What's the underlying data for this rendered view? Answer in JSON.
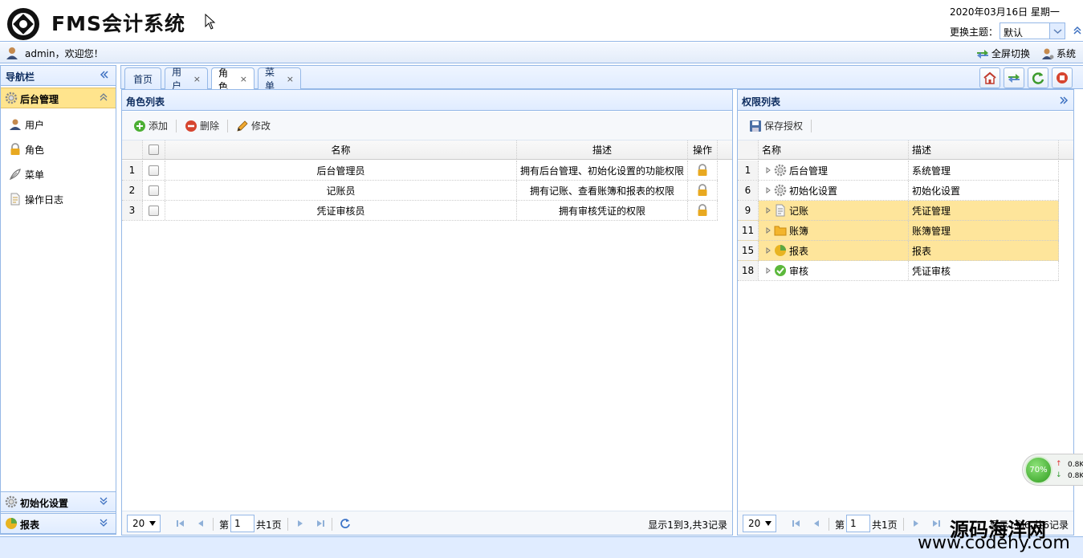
{
  "header": {
    "app_title": "FMS会计系统",
    "date": "2020年03月16日 星期一",
    "theme_label": "更换主题：",
    "theme_value": "默认"
  },
  "userbar": {
    "welcome": "admin，欢迎您！",
    "fullscreen": "全屏切换",
    "system": "系统"
  },
  "sidebar": {
    "title": "导航栏",
    "sections": [
      {
        "label": "后台管理",
        "items": [
          "用户",
          "角色",
          "菜单",
          "操作日志"
        ]
      },
      {
        "label": "初始化设置"
      },
      {
        "label": "报表"
      }
    ]
  },
  "tabs": [
    {
      "label": "首页"
    },
    {
      "label": "用户",
      "close": "×"
    },
    {
      "label": "角色",
      "close": "×"
    },
    {
      "label": "菜单",
      "close": "×"
    }
  ],
  "role_panel": {
    "title": "角色列表",
    "toolbar": {
      "add": "添加",
      "delete": "删除",
      "edit": "修改"
    },
    "columns": {
      "name": "名称",
      "desc": "描述",
      "op": "操作"
    },
    "rows": [
      {
        "n": "1",
        "name": "后台管理员",
        "desc": "拥有后台管理、初始化设置的功能权限"
      },
      {
        "n": "2",
        "name": "记账员",
        "desc": "拥有记账、查看账簿和报表的权限"
      },
      {
        "n": "3",
        "name": "凭证审核员",
        "desc": "拥有审核凭证的权限"
      }
    ],
    "pager": {
      "size": "20",
      "page_prefix": "第",
      "page": "1",
      "page_suffix": "共1页",
      "info": "显示1到3,共3记录"
    }
  },
  "perm_panel": {
    "title": "权限列表",
    "toolbar": {
      "save": "保存授权"
    },
    "columns": {
      "name": "名称",
      "desc": "描述"
    },
    "rows": [
      {
        "n": "1",
        "name": "后台管理",
        "desc": "系统管理",
        "icon": "gear-icon"
      },
      {
        "n": "6",
        "name": "初始化设置",
        "desc": "初始化设置",
        "icon": "gear-icon"
      },
      {
        "n": "9",
        "name": "记账",
        "desc": "凭证管理",
        "icon": "document-icon",
        "highlight": true
      },
      {
        "n": "11",
        "name": "账簿",
        "desc": "账簿管理",
        "icon": "folder-icon",
        "highlight": true
      },
      {
        "n": "15",
        "name": "报表",
        "desc": "报表",
        "icon": "chart-icon",
        "highlight": true
      },
      {
        "n": "18",
        "name": "审核",
        "desc": "凭证审核",
        "icon": "check-icon"
      }
    ],
    "pager": {
      "size": "20",
      "page_prefix": "第",
      "page": "1",
      "page_suffix": "共1页",
      "info": "显示1到6,共6记录"
    }
  },
  "speed_widget": {
    "percent": "70%",
    "up": "0.8K",
    "down": "0.8K"
  },
  "watermark": {
    "line1": "源码海洋网",
    "line2": "www.codehy.com"
  },
  "colors": {
    "accent": "#95b8e7",
    "selected": "#ffe48d",
    "highlight": "#fee59b"
  }
}
